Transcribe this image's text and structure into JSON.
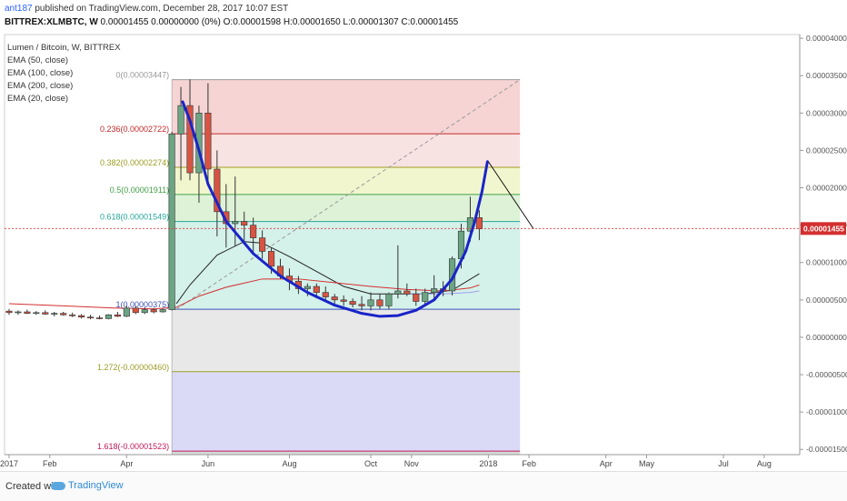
{
  "header": {
    "user": "ant187",
    "published": " published on TradingView.com, December 28, 2017 10:07 EST",
    "symbol": "BITTREX:XLMBTC, W",
    "ohlc": " 0.00001455 0.00000000 (0%) O:0.00001598 H:0.00001650 L:0.00001307 C:0.00001455"
  },
  "legend": [
    "Lumen / Bitcoin, W, BITTREX",
    "EMA (50, close)",
    "EMA (100, close)",
    "EMA (200, close)",
    "EMA (20, close)"
  ],
  "footer": {
    "created": "Created with",
    "brand": "TradingView"
  },
  "colors": {
    "up": "#6ba583",
    "down": "#d75442",
    "ema20": "#222222",
    "ema50": "#d32f2f",
    "ema100": "#9e9ef0",
    "ema200": "#c2185b",
    "curve": "#1a24c8",
    "price_line": "#e53935"
  },
  "chart_data": {
    "type": "candlestick",
    "title": "",
    "x_ticks": [
      {
        "label": "2017",
        "w": 0
      },
      {
        "label": "Feb",
        "w": 4.5
      },
      {
        "label": "Apr",
        "w": 13
      },
      {
        "label": "Jun",
        "w": 22
      },
      {
        "label": "Aug",
        "w": 31
      },
      {
        "label": "Oct",
        "w": 40
      },
      {
        "label": "Nov",
        "w": 44.5
      },
      {
        "label": "2018",
        "w": 53
      },
      {
        "label": "Feb",
        "w": 57.5
      },
      {
        "label": "Apr",
        "w": 66
      },
      {
        "label": "May",
        "w": 70.5
      },
      {
        "label": "Jul",
        "w": 79
      },
      {
        "label": "Aug",
        "w": 83.5
      }
    ],
    "y_ticks": [
      "0.00004000",
      "0.00003500",
      "0.00003000",
      "0.00002500",
      "0.00002000",
      "0.00001500",
      "0.00001000",
      "0.00000500",
      "0.00000000",
      "-0.00000500",
      "-0.00001000",
      "-0.00001500"
    ],
    "y_tick_values": [
      4e-05,
      3.5e-05,
      3e-05,
      2.5e-05,
      2e-05,
      1.5e-05,
      1e-05,
      5e-06,
      0,
      -5e-06,
      -1e-05,
      -1.5e-05
    ],
    "ylim": [
      -1.57e-05,
      4.05e-05
    ],
    "last_price": "0.00001455",
    "last_price_value": 1.455e-05,
    "fib": {
      "start_week": 18,
      "end_week": 56.5,
      "levels": [
        {
          "label": "0(0.00003447)",
          "value": 3.447e-05,
          "color": "#999999"
        },
        {
          "label": "0.236(0.00002722)",
          "value": 2.722e-05,
          "color": "#c62828"
        },
        {
          "label": "0.382(0.00002274)",
          "value": 2.274e-05,
          "color": "#9e9d24"
        },
        {
          "label": "0.5(0.00001911)",
          "value": 1.911e-05,
          "color": "#43a047"
        },
        {
          "label": "0.618(0.00001549)",
          "value": 1.549e-05,
          "color": "#26a69a"
        },
        {
          "label": "1(0.00000375)",
          "value": 3.75e-06,
          "color": "#3f51b5"
        },
        {
          "label": "1.272(-0.00000460)",
          "value": -4.6e-06,
          "color": "#9e9d24"
        },
        {
          "label": "1.618(-0.00001523)",
          "value": -1.523e-05,
          "color": "#c2185b"
        }
      ]
    },
    "candles": [
      {
        "w": 0,
        "o": 3.5e-06,
        "h": 3.8e-06,
        "l": 3e-06,
        "c": 3.3e-06
      },
      {
        "w": 1,
        "o": 3.3e-06,
        "h": 3.6e-06,
        "l": 3e-06,
        "c": 3.4e-06
      },
      {
        "w": 2,
        "o": 3.4e-06,
        "h": 3.7e-06,
        "l": 3.1e-06,
        "c": 3.2e-06
      },
      {
        "w": 3,
        "o": 3.2e-06,
        "h": 3.5e-06,
        "l": 3e-06,
        "c": 3.3e-06
      },
      {
        "w": 4,
        "o": 3.3e-06,
        "h": 3.6e-06,
        "l": 3e-06,
        "c": 3.1e-06
      },
      {
        "w": 5,
        "o": 3.1e-06,
        "h": 3.4e-06,
        "l": 2.8e-06,
        "c": 3.2e-06
      },
      {
        "w": 6,
        "o": 3.2e-06,
        "h": 3.4e-06,
        "l": 2.9e-06,
        "c": 3e-06
      },
      {
        "w": 7,
        "o": 3e-06,
        "h": 3.3e-06,
        "l": 2.7e-06,
        "c": 2.9e-06
      },
      {
        "w": 8,
        "o": 2.9e-06,
        "h": 3.1e-06,
        "l": 2.5e-06,
        "c": 2.7e-06
      },
      {
        "w": 9,
        "o": 2.7e-06,
        "h": 3e-06,
        "l": 2.4e-06,
        "c": 2.6e-06
      },
      {
        "w": 10,
        "o": 2.6e-06,
        "h": 2.9e-06,
        "l": 2.4e-06,
        "c": 2.5e-06
      },
      {
        "w": 11,
        "o": 2.5e-06,
        "h": 3.1e-06,
        "l": 2.4e-06,
        "c": 3e-06
      },
      {
        "w": 12,
        "o": 3e-06,
        "h": 3.4e-06,
        "l": 2.7e-06,
        "c": 2.8e-06
      },
      {
        "w": 13,
        "o": 2.8e-06,
        "h": 4.2e-06,
        "l": 2.7e-06,
        "c": 3.9e-06
      },
      {
        "w": 14,
        "o": 3.9e-06,
        "h": 4.2e-06,
        "l": 3.1e-06,
        "c": 3.3e-06
      },
      {
        "w": 15,
        "o": 3.3e-06,
        "h": 4e-06,
        "l": 3.1e-06,
        "c": 3.7e-06
      },
      {
        "w": 16,
        "o": 3.7e-06,
        "h": 3.9e-06,
        "l": 3.2e-06,
        "c": 3.4e-06
      },
      {
        "w": 17,
        "o": 3.4e-06,
        "h": 3.9e-06,
        "l": 3.3e-06,
        "c": 3.7e-06
      },
      {
        "w": 18,
        "o": 3.7e-06,
        "h": 2.75e-05,
        "l": 3.6e-06,
        "c": 2.72e-05
      },
      {
        "w": 19,
        "o": 2.72e-05,
        "h": 3.35e-05,
        "l": 2.1e-05,
        "c": 3.1e-05
      },
      {
        "w": 20,
        "o": 3.1e-05,
        "h": 3.45e-05,
        "l": 2.1e-05,
        "c": 2.2e-05
      },
      {
        "w": 21,
        "o": 2.2e-05,
        "h": 3.1e-05,
        "l": 1.8e-05,
        "c": 3e-05
      },
      {
        "w": 22,
        "o": 3e-05,
        "h": 3.4e-05,
        "l": 2.1e-05,
        "c": 2.25e-05
      },
      {
        "w": 23,
        "o": 2.25e-05,
        "h": 2.5e-05,
        "l": 1.35e-05,
        "c": 1.68e-05
      },
      {
        "w": 24,
        "o": 1.68e-05,
        "h": 2.05e-05,
        "l": 1.2e-05,
        "c": 1.52e-05
      },
      {
        "w": 25,
        "o": 1.52e-05,
        "h": 2.15e-05,
        "l": 1.22e-05,
        "c": 1.55e-05
      },
      {
        "w": 26,
        "o": 1.55e-05,
        "h": 1.68e-05,
        "l": 1.25e-05,
        "c": 1.5e-05
      },
      {
        "w": 27,
        "o": 1.5e-05,
        "h": 1.6e-05,
        "l": 1.12e-05,
        "c": 1.33e-05
      },
      {
        "w": 28,
        "o": 1.33e-05,
        "h": 1.43e-05,
        "l": 1.05e-05,
        "c": 1.15e-05
      },
      {
        "w": 29,
        "o": 1.15e-05,
        "h": 1.2e-05,
        "l": 8.5e-06,
        "c": 9.5e-06
      },
      {
        "w": 30,
        "o": 9.5e-06,
        "h": 1.05e-05,
        "l": 7.8e-06,
        "c": 8.2e-06
      },
      {
        "w": 31,
        "o": 8.2e-06,
        "h": 9.2e-06,
        "l": 6.3e-06,
        "c": 7.5e-06
      },
      {
        "w": 32,
        "o": 7.5e-06,
        "h": 8.2e-06,
        "l": 5.8e-06,
        "c": 6.5e-06
      },
      {
        "w": 33,
        "o": 6.5e-06,
        "h": 7.2e-06,
        "l": 5.5e-06,
        "c": 6.8e-06
      },
      {
        "w": 34,
        "o": 6.8e-06,
        "h": 7.2e-06,
        "l": 5.2e-06,
        "c": 6e-06
      },
      {
        "w": 35,
        "o": 6e-06,
        "h": 6.8e-06,
        "l": 5e-06,
        "c": 5.4e-06
      },
      {
        "w": 36,
        "o": 5.4e-06,
        "h": 5.8e-06,
        "l": 4.5e-06,
        "c": 5e-06
      },
      {
        "w": 37,
        "o": 5e-06,
        "h": 5.6e-06,
        "l": 4.2e-06,
        "c": 4.8e-06
      },
      {
        "w": 38,
        "o": 4.8e-06,
        "h": 5.2e-06,
        "l": 4e-06,
        "c": 4.4e-06
      },
      {
        "w": 39,
        "o": 4.4e-06,
        "h": 5.5e-06,
        "l": 3.6e-06,
        "c": 4.2e-06
      },
      {
        "w": 40,
        "o": 4.2e-06,
        "h": 6e-06,
        "l": 3.6e-06,
        "c": 5e-06
      },
      {
        "w": 41,
        "o": 5e-06,
        "h": 5.8e-06,
        "l": 3.8e-06,
        "c": 4.2e-06
      },
      {
        "w": 42,
        "o": 4.2e-06,
        "h": 6e-06,
        "l": 3.8e-06,
        "c": 5.8e-06
      },
      {
        "w": 43,
        "o": 5.8e-06,
        "h": 1.23e-05,
        "l": 5.2e-06,
        "c": 6.2e-06
      },
      {
        "w": 44,
        "o": 6.2e-06,
        "h": 7.2e-06,
        "l": 5.5e-06,
        "c": 5.8e-06
      },
      {
        "w": 45,
        "o": 5.8e-06,
        "h": 6.5e-06,
        "l": 4.2e-06,
        "c": 4.8e-06
      },
      {
        "w": 46,
        "o": 4.8e-06,
        "h": 6.5e-06,
        "l": 4.2e-06,
        "c": 6e-06
      },
      {
        "w": 47,
        "o": 6e-06,
        "h": 8.3e-06,
        "l": 5e-06,
        "c": 6.5e-06
      },
      {
        "w": 48,
        "o": 6.5e-06,
        "h": 7.5e-06,
        "l": 5.5e-06,
        "c": 6.2e-06
      },
      {
        "w": 49,
        "o": 6.2e-06,
        "h": 1.08e-05,
        "l": 5.6e-06,
        "c": 1.05e-05
      },
      {
        "w": 50,
        "o": 1.05e-05,
        "h": 1.52e-05,
        "l": 9.2e-06,
        "c": 1.42e-05
      },
      {
        "w": 51,
        "o": 1.42e-05,
        "h": 1.88e-05,
        "l": 1.28e-05,
        "c": 1.6e-05
      },
      {
        "w": 52,
        "o": 1.6e-05,
        "h": 1.7e-05,
        "l": 1.3e-05,
        "c": 1.45e-05
      }
    ],
    "ema": [
      {
        "name": "EMA (20, close)",
        "color": "#222222",
        "points": [
          [
            18.5,
            4.5e-06
          ],
          [
            20,
            7e-06
          ],
          [
            23,
            1.1e-05
          ],
          [
            26,
            1.28e-05
          ],
          [
            28,
            1.26e-05
          ],
          [
            31,
            1.08e-05
          ],
          [
            34,
            8.8e-06
          ],
          [
            37,
            6.8e-06
          ],
          [
            40,
            5.8e-06
          ],
          [
            43,
            5.8e-06
          ],
          [
            46,
            5.8e-06
          ],
          [
            49,
            6.3e-06
          ],
          [
            52,
            8.5e-06
          ]
        ]
      },
      {
        "name": "EMA (50, close)",
        "color": "#d32f2f",
        "points": [
          [
            0,
            4.5e-06
          ],
          [
            6,
            4.2e-06
          ],
          [
            12,
            3.9e-06
          ],
          [
            16,
            3.8e-06
          ],
          [
            18.5,
            4e-06
          ],
          [
            21,
            5.5e-06
          ],
          [
            24,
            6.7e-06
          ],
          [
            28,
            7.8e-06
          ],
          [
            32,
            7.8e-06
          ],
          [
            36,
            7.3e-06
          ],
          [
            40,
            6.8e-06
          ],
          [
            44,
            6.4e-06
          ],
          [
            48,
            6.2e-06
          ],
          [
            51,
            6.6e-06
          ],
          [
            52,
            7e-06
          ]
        ]
      },
      {
        "name": "EMA (100, close)",
        "color": "#9e9ef0",
        "points": [
          [
            44,
            5.8e-06
          ],
          [
            48,
            5.8e-06
          ],
          [
            51,
            6e-06
          ],
          [
            52,
            6.2e-06
          ]
        ]
      }
    ],
    "trend_line": [
      [
        18.5,
        3.75e-06
      ],
      [
        56.5,
        3.447e-05
      ]
    ],
    "curve": [
      [
        19.2,
        3.15e-05
      ],
      [
        20,
        2.9e-05
      ],
      [
        21,
        2.5e-05
      ],
      [
        22,
        2.05e-05
      ],
      [
        24,
        1.55e-05
      ],
      [
        27,
        1.12e-05
      ],
      [
        30,
        8.2e-06
      ],
      [
        33,
        6e-06
      ],
      [
        36,
        4.3e-06
      ],
      [
        39,
        3.2e-06
      ],
      [
        41,
        2.8e-06
      ],
      [
        43,
        2.9e-06
      ],
      [
        45,
        3.6e-06
      ],
      [
        47,
        5e-06
      ],
      [
        49,
        7.8e-06
      ],
      [
        50.5,
        1.15e-05
      ],
      [
        51.5,
        1.55e-05
      ],
      [
        52.3,
        1.95e-05
      ],
      [
        52.9,
        2.35e-05
      ]
    ],
    "projection": [
      [
        53,
        2.35e-05
      ],
      [
        55.5,
        1.9e-05
      ],
      [
        58,
        1.45e-05
      ]
    ]
  }
}
